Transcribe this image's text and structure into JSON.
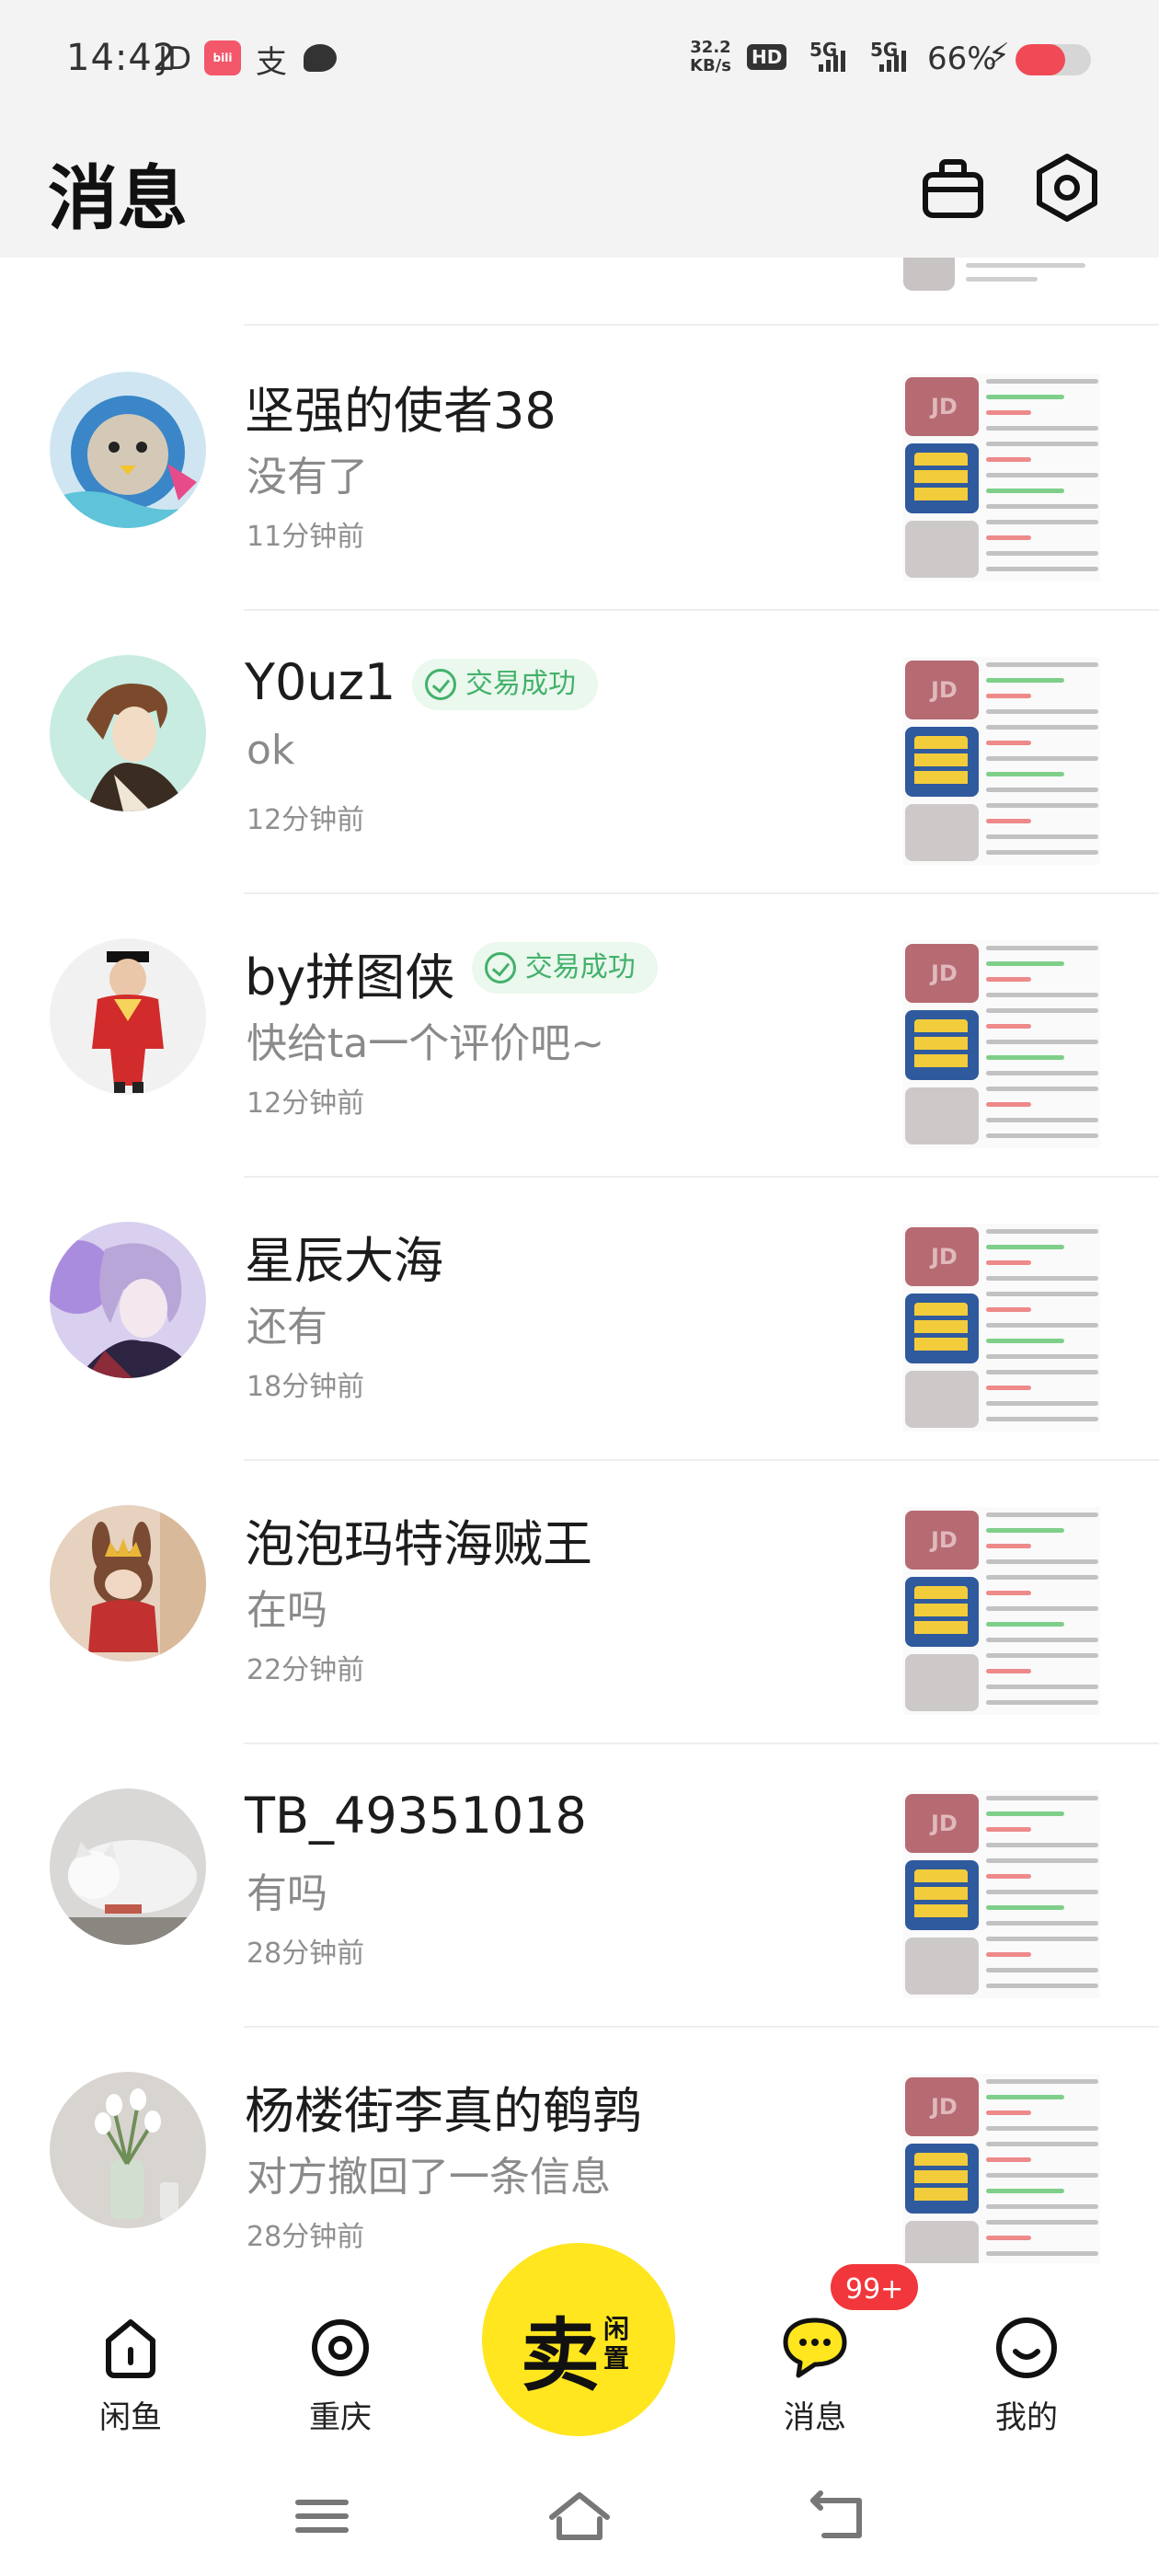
{
  "status_bar": {
    "time": "14:42",
    "carrier": "JD",
    "pay_icon": "支",
    "speed_value": "32.2",
    "speed_unit": "KB/s",
    "hd": "HD",
    "sig1": "5G",
    "sig2": "5G",
    "battery_text": "66%",
    "battery_level": 0.66,
    "battery_color": "#f04a56"
  },
  "header": {
    "title": "消息",
    "icons": [
      "bag-icon",
      "settings-icon"
    ]
  },
  "badge_text": "交易成功",
  "conversations": [
    {
      "name": "坚强的使者38",
      "preview": "没有了",
      "time": "11分钟前",
      "badge": false,
      "avatar": "seal-avatar"
    },
    {
      "name": "Y0uz1",
      "preview": "ok",
      "time": "12分钟前",
      "badge": true,
      "avatar": "anime-boy-avatar"
    },
    {
      "name": "by拼图侠",
      "preview": "快给ta一个评价吧~",
      "time": "12分钟前",
      "badge": true,
      "avatar": "red-figure-avatar"
    },
    {
      "name": "星辰大海",
      "preview": "还有",
      "time": "18分钟前",
      "badge": false,
      "avatar": "anime-purple-avatar"
    },
    {
      "name": "泡泡玛特海贼王",
      "preview": "在吗",
      "time": "22分钟前",
      "badge": false,
      "avatar": "toy-figure-avatar"
    },
    {
      "name": "TB_49351018",
      "preview": "有吗",
      "time": "28分钟前",
      "badge": false,
      "avatar": "cat-avatar"
    },
    {
      "name": "杨楼街李真的鹌鹑",
      "preview": "对方撤回了一条信息",
      "time": "28分钟前",
      "badge": false,
      "avatar": "flower-vase-avatar"
    }
  ],
  "tabbar": {
    "home": "闲鱼",
    "location": "重庆",
    "sell_main": "卖",
    "sell_sub": "闲置",
    "messages": "消息",
    "messages_badge": "99+",
    "me": "我的",
    "accent": "#ffe61f"
  }
}
